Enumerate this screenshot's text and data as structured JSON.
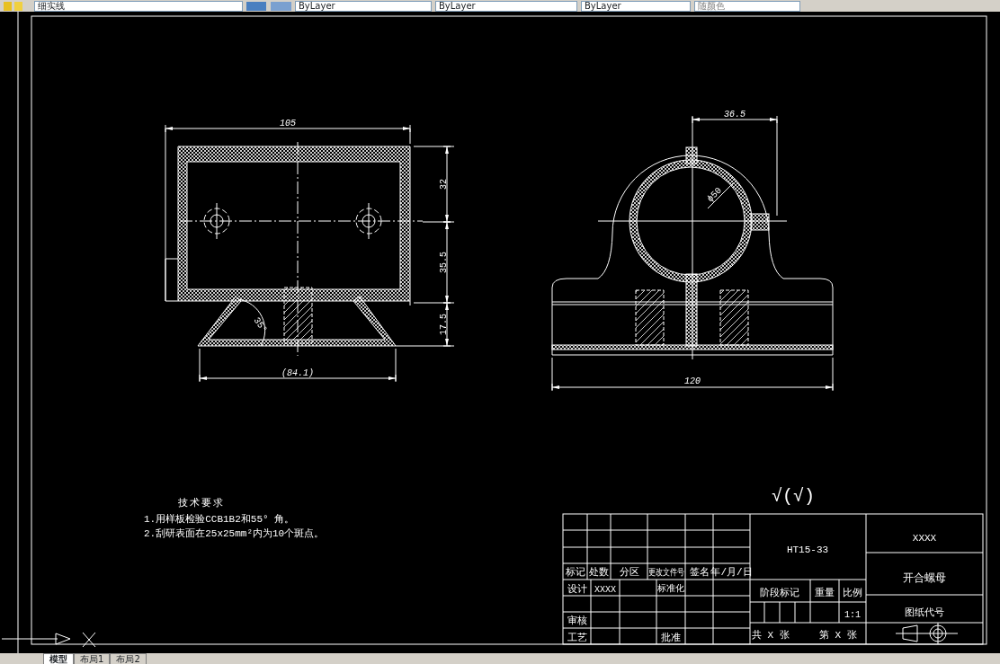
{
  "toolbar": {
    "layer": "细实线",
    "linetype": "ByLayer",
    "lineweight": "ByLayer",
    "plotstyle": "ByLayer",
    "color_dropdown": "随颜色"
  },
  "front_view": {
    "dims": [
      "105",
      "32",
      "35.5",
      "17.5",
      "(84.1)",
      "35°"
    ]
  },
  "side_view": {
    "dims": [
      "36.5",
      "ϕ50",
      "120"
    ]
  },
  "roughness": "√(√)",
  "notes": {
    "title": "技术要求",
    "items": [
      "1.用样板检验CCB1B2和55° 角。",
      "2.刮研表面在25x25mm²内为10个斑点。"
    ]
  },
  "title_block": {
    "header_labels": [
      "标记",
      "处数",
      "分区",
      "更改文件号",
      "签名",
      "年/月/日"
    ],
    "designer_label": "设计",
    "designer": "XXXX",
    "standardization_label": "标准化",
    "review_label": "审核",
    "process_label": "工艺",
    "approve_label": "批准",
    "material": "HT15-33",
    "company": "XXXX",
    "part_name": "开合螺母",
    "drawing_no_label": "图纸代号",
    "stage_label": "阶段标记",
    "weight_label": "重量",
    "scale_label": "比例",
    "scale": "1:1",
    "sheets_total": "共 X 张",
    "sheet_no": "第 X 张"
  },
  "layout_tabs": [
    {
      "label": "模型",
      "selected": true
    },
    {
      "label": "布局1",
      "selected": false
    },
    {
      "label": "布局2",
      "selected": false
    }
  ]
}
